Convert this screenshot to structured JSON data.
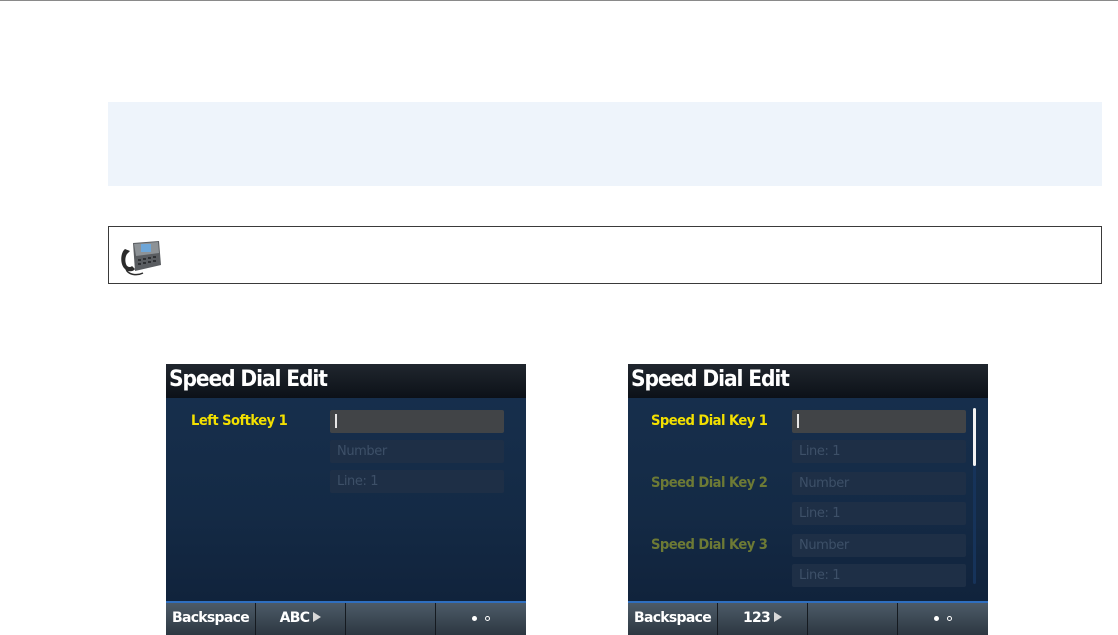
{
  "screens": [
    {
      "title": "Speed Dial Edit",
      "fields": [
        {
          "label": "Left Softkey 1",
          "active": true,
          "inputs": [
            {
              "value": "",
              "cursor": true
            },
            {
              "value": "Number"
            },
            {
              "value": "Line: 1"
            }
          ]
        }
      ],
      "softkeys": [
        "Backspace",
        "ABC",
        "",
        ""
      ],
      "page_indicator": {
        "current": 1,
        "total": 2
      }
    },
    {
      "title": "Speed Dial Edit",
      "fields": [
        {
          "label": "Speed Dial Key 1",
          "active": true,
          "inputs": [
            {
              "value": "",
              "cursor": true
            },
            {
              "value": "Line: 1"
            }
          ]
        },
        {
          "label": "Speed Dial Key 2",
          "active": false,
          "inputs": [
            {
              "value": "Number"
            },
            {
              "value": "Line: 1"
            }
          ]
        },
        {
          "label": "Speed Dial Key 3",
          "active": false,
          "inputs": [
            {
              "value": "Number"
            },
            {
              "value": "Line: 1"
            }
          ]
        }
      ],
      "softkeys": [
        "Backspace",
        "123",
        "",
        ""
      ],
      "page_indicator": {
        "current": 1,
        "total": 2
      },
      "scroll_position": 0.0
    }
  ],
  "icons": {
    "phone_banner": "desk-phone-icon",
    "softkey_arrow": "triangle-right-icon"
  },
  "colors": {
    "label_active": "#f3e000",
    "label_inactive": "#6d7a35",
    "softkey_accent": "#2f6fc0",
    "note_bg": "#eef4fb"
  }
}
